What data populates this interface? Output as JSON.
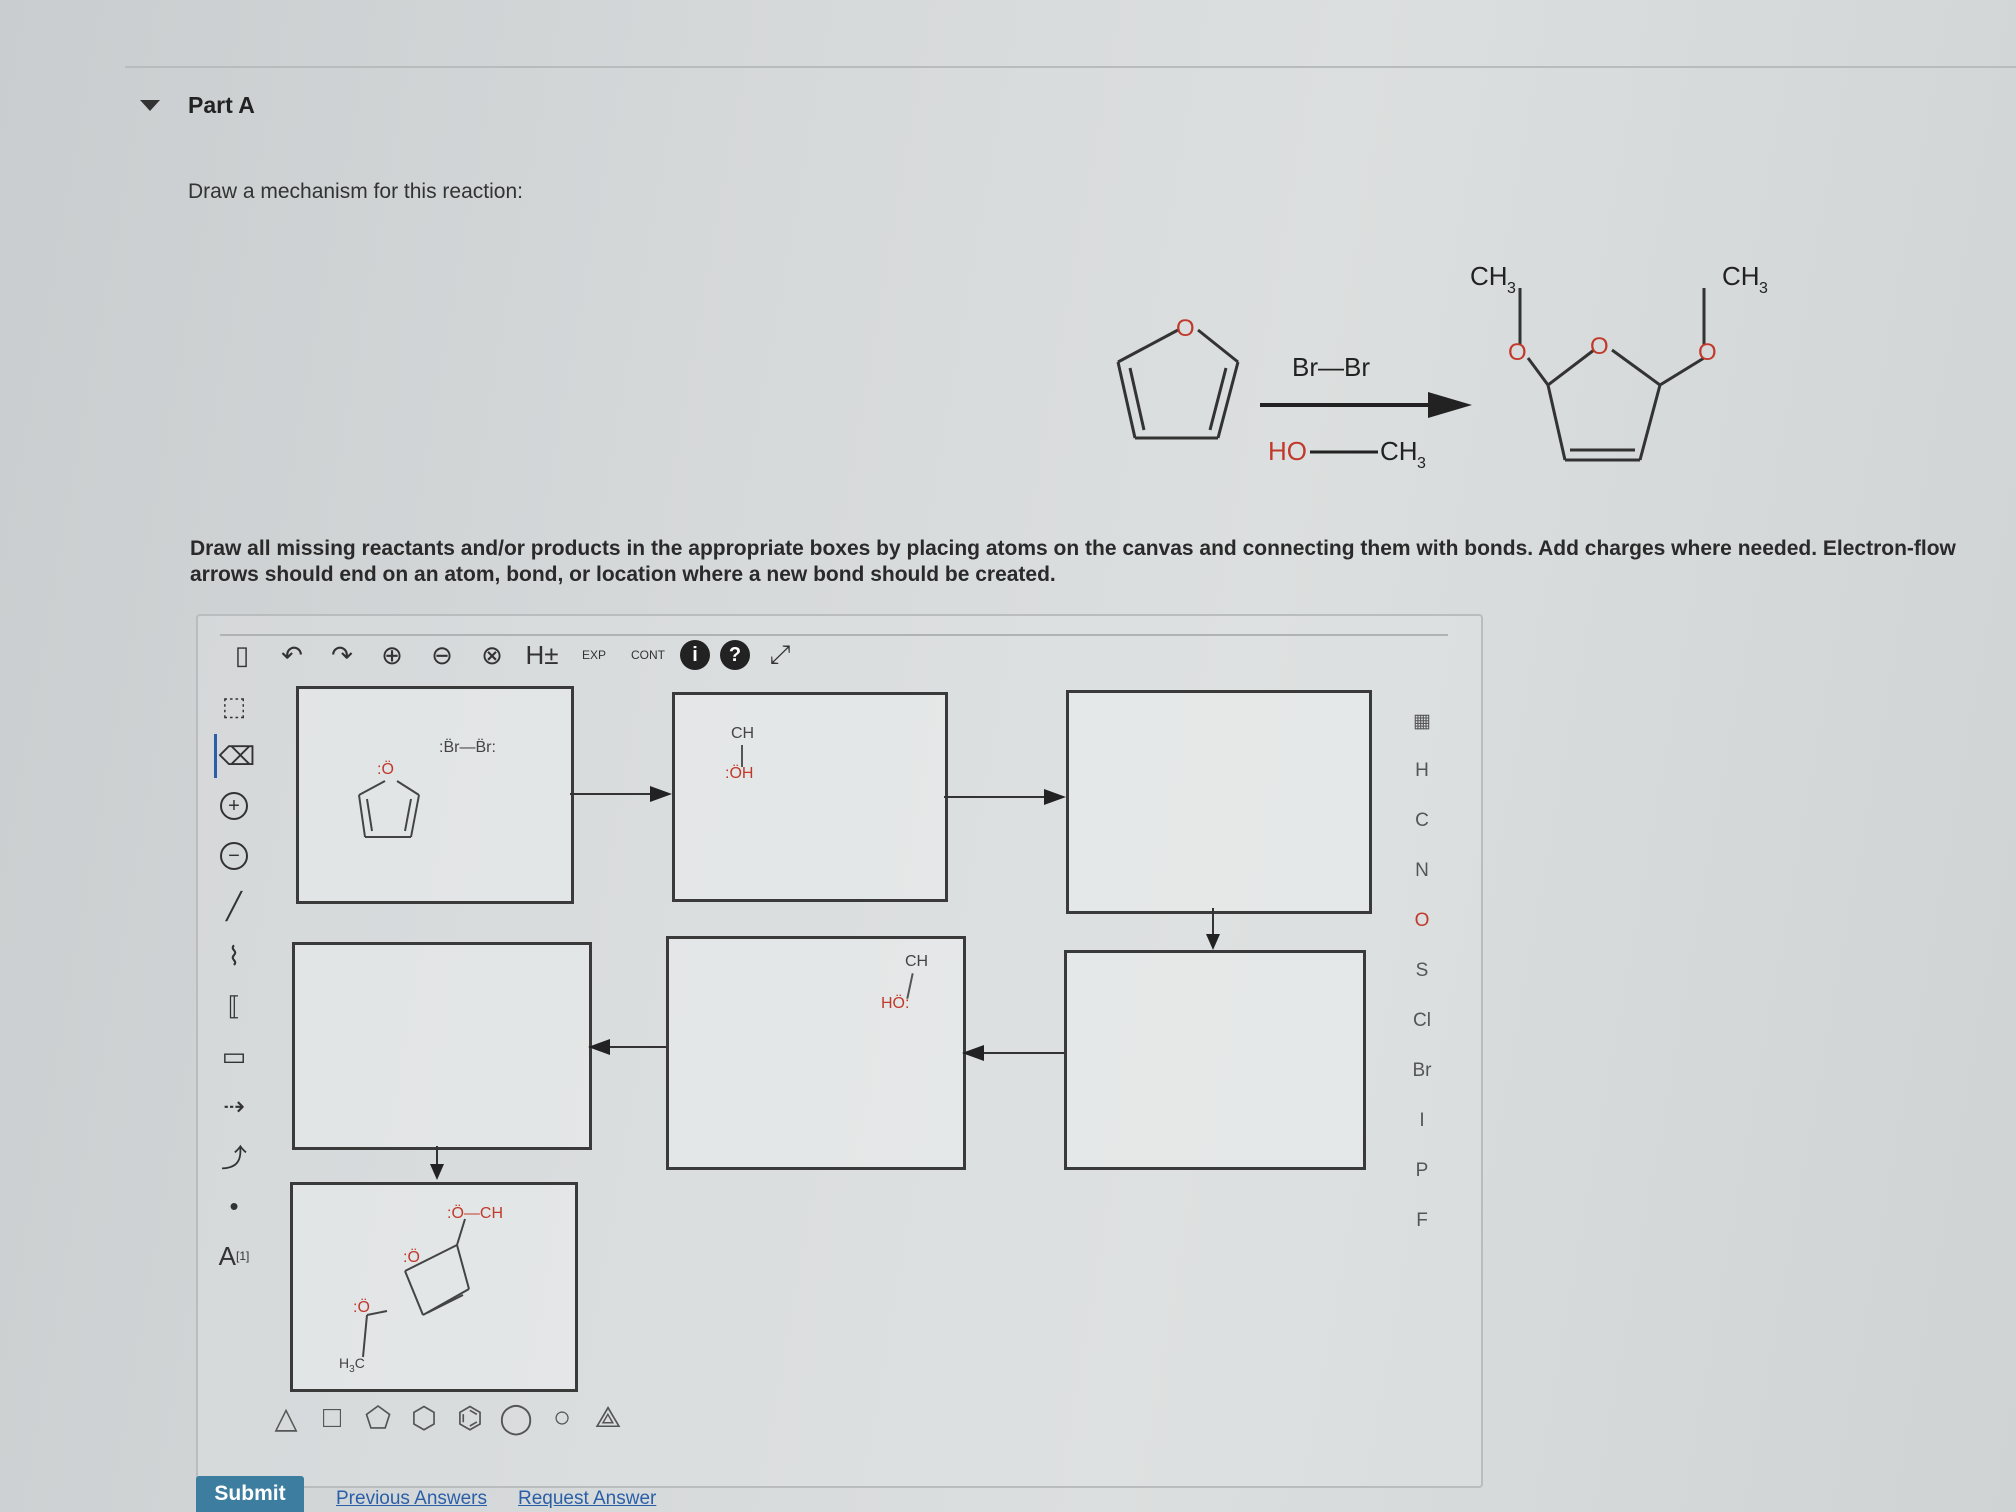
{
  "part": {
    "title": "Part A"
  },
  "question": {
    "text": "Draw a mechanism for this reaction:"
  },
  "reaction": {
    "reagent_top": "Br—Br",
    "reagent_bottom_left": "HO",
    "reagent_bottom_right": "CH",
    "sub_3": "3",
    "o_label": "O",
    "ch3_label": "CH",
    "sub3": "3"
  },
  "instructions": "Draw all missing reactants and/or products in the appropriate boxes by placing atoms on the canvas and connecting them with bonds. Add charges where needed. Electron-flow arrows should end on an atom, bond, or location where a new bond should be created.",
  "toolbar": {
    "hplus": "H±",
    "exp": "EXP",
    "cont": "CONT",
    "info": "i",
    "help": "?"
  },
  "left_tools": {
    "text_tool": "A",
    "text_tool_sup": "[1]"
  },
  "elements": [
    "H",
    "C",
    "N",
    "O",
    "S",
    "Cl",
    "Br",
    "I",
    "P",
    "F"
  ],
  "boxes": {
    "box1": {
      "br2": ":B̈r—B̈r:",
      "o": ":Ö"
    },
    "box2": {
      "ch3": "CH",
      "oh": ":ÖH"
    },
    "box5": {
      "ch3": "CH",
      "ho": "HÖ:"
    },
    "box7": {
      "o1": ":Ö—CH",
      "o2": ":Ö",
      "o3": ":Ö",
      "h3c": "H",
      "h3c_c": "C"
    }
  },
  "actions": {
    "submit": "Submit",
    "previous": "Previous Answers",
    "request": "Request Answer"
  }
}
